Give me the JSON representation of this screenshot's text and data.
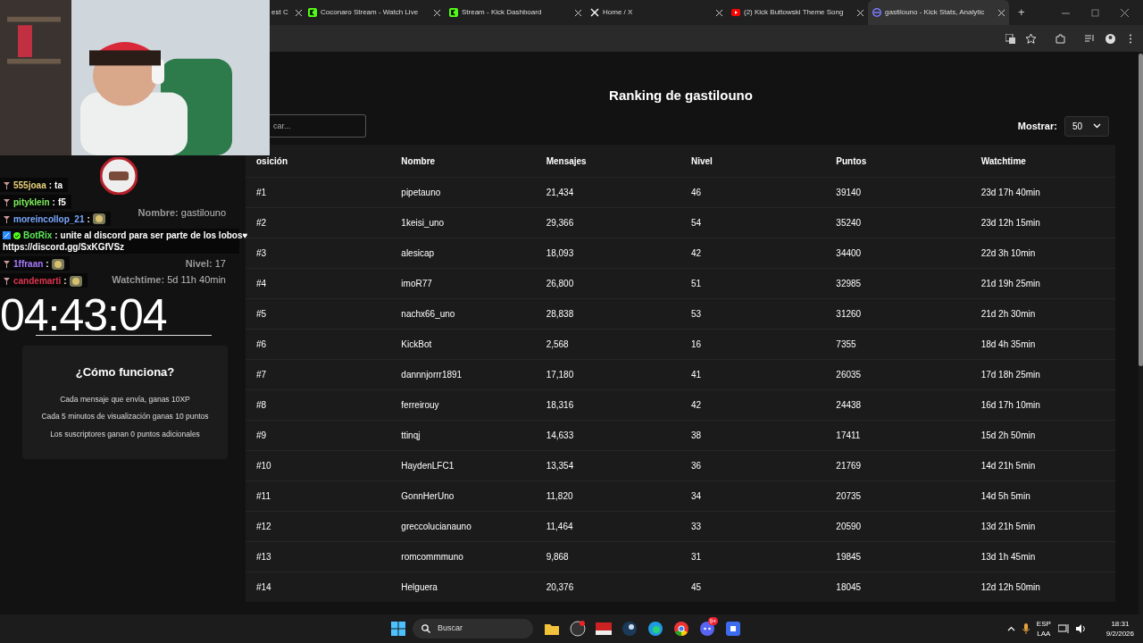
{
  "browser": {
    "tabs": [
      {
        "title": "est C",
        "kind": "plain",
        "selected": false
      },
      {
        "title": "Coconaro Stream - Watch Live",
        "kind": "kick",
        "selected": false
      },
      {
        "title": "Stream - Kick Dashboard",
        "kind": "kick",
        "selected": false
      },
      {
        "title": "Home / X",
        "kind": "x",
        "selected": false
      },
      {
        "title": "(2) Kick Buttowski Theme Song",
        "kind": "video",
        "selected": false
      },
      {
        "title": "gastilouno - Kick Stats, Analytic",
        "kind": "stats",
        "selected": true
      }
    ],
    "new_tab": "+"
  },
  "sidebar": {
    "profile": {
      "name_label": "Nombre:",
      "name": "gastilouno",
      "level_label": "Nivel:",
      "level": "17",
      "watch_label": "Watchtime:",
      "watch": "5d 11h 40min"
    },
    "info": {
      "title": "¿Cómo funciona?",
      "lines": [
        "Cada mensaje que envía, ganas 10XP",
        "Cada 5 minutos de visualización ganas 10 puntos",
        "Los suscriptores ganan 0 puntos adicionales"
      ]
    }
  },
  "page": {
    "title": "Ranking de gastilouno",
    "search": {
      "placeholder": "car..."
    },
    "show_label": "Mostrar:",
    "show_value": "50",
    "columns": [
      "osición",
      "Nombre",
      "Mensajes",
      "Nivel",
      "Puntos",
      "Watchtime"
    ],
    "rows": [
      [
        "#1",
        "pipetauno",
        "21,434",
        "46",
        "39140",
        "23d 17h 40min"
      ],
      [
        "#2",
        "1keisi_uno",
        "29,366",
        "54",
        "35240",
        "23d 12h 15min"
      ],
      [
        "#3",
        "alesicap",
        "18,093",
        "42",
        "34400",
        "22d 3h 10min"
      ],
      [
        "#4",
        "imoR77",
        "26,800",
        "51",
        "32985",
        "21d 19h 25min"
      ],
      [
        "#5",
        "nachx66_uno",
        "28,838",
        "53",
        "31260",
        "21d 2h 30min"
      ],
      [
        "#6",
        "KickBot",
        "2,568",
        "16",
        "7355",
        "18d 4h 35min"
      ],
      [
        "#7",
        "dannnjorrr1891",
        "17,180",
        "41",
        "26035",
        "17d 18h 25min"
      ],
      [
        "#8",
        "ferreirouy",
        "18,316",
        "42",
        "24438",
        "16d 17h 10min"
      ],
      [
        "#9",
        "ttinqj",
        "14,633",
        "38",
        "17411",
        "15d 2h 50min"
      ],
      [
        "#10",
        "HaydenLFC1",
        "13,354",
        "36",
        "21769",
        "14d 21h 5min"
      ],
      [
        "#11",
        "GonnHerUno",
        "11,820",
        "34",
        "20735",
        "14d 5h 5min"
      ],
      [
        "#12",
        "greccolucianauno",
        "11,464",
        "33",
        "20590",
        "13d 21h 5min"
      ],
      [
        "#13",
        "romcommmuno",
        "9,868",
        "31",
        "19845",
        "13d 1h 45min"
      ],
      [
        "#14",
        "Helguera",
        "20,376",
        "45",
        "18045",
        "12d 12h 50min"
      ]
    ]
  },
  "chat": {
    "messages": [
      {
        "user": "555joaa",
        "sep": ":",
        "color": "#e8d27a",
        "text": "ta",
        "emote": false,
        "bot": false
      },
      {
        "user": "pityklein",
        "sep": ":",
        "color": "#7cf05a",
        "text": "f5",
        "emote": false,
        "bot": false
      },
      {
        "user": "moreincollop_21",
        "sep": ":",
        "color": "#7aa8ff",
        "emote": true,
        "bot": false
      },
      {
        "user": "BotRix",
        "sep": ":",
        "color": "#5ee85a",
        "text": "unite al discord para ser parte de los lobos♥",
        "link": "https://discord.gg/SxKGfVSz",
        "emote": false,
        "bot": true
      },
      {
        "user": "1ffraan",
        "sep": ":",
        "color": "#a77bff",
        "emote": true,
        "bot": false
      },
      {
        "user": "candemarti",
        "sep": ":",
        "color": "#e0354d",
        "emote": true,
        "bot": false
      }
    ]
  },
  "timer": "04:43:04",
  "taskbar": {
    "search": "Buscar",
    "discord_badge": "9+",
    "lang": "ESP",
    "region": "LAA",
    "time": "18:31",
    "date": "9/2/2026"
  }
}
